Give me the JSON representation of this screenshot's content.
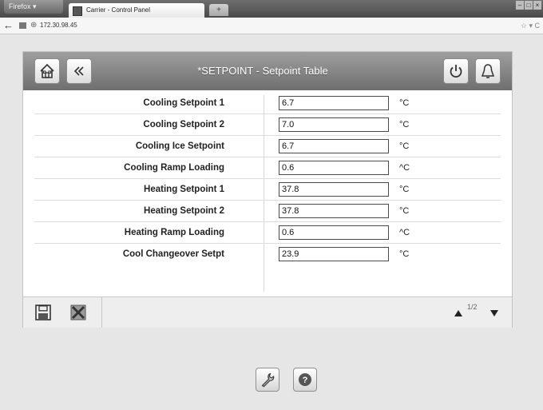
{
  "browser": {
    "app_button": "Firefox ▾",
    "tab_title": "Carrier - Control Panel",
    "new_tab_symbol": "+",
    "url": "172.30.98.45"
  },
  "header": {
    "title": "*SETPOINT - Setpoint Table"
  },
  "setpoints": [
    {
      "label": "Cooling Setpoint 1",
      "value": "6.7",
      "unit": "°C"
    },
    {
      "label": "Cooling Setpoint 2",
      "value": "7.0",
      "unit": "°C"
    },
    {
      "label": "Cooling Ice Setpoint",
      "value": "6.7",
      "unit": "°C"
    },
    {
      "label": "Cooling Ramp Loading",
      "value": "0.6",
      "unit": "^C"
    },
    {
      "label": "Heating Setpoint 1",
      "value": "37.8",
      "unit": "°C"
    },
    {
      "label": "Heating Setpoint 2",
      "value": "37.8",
      "unit": "°C"
    },
    {
      "label": "Heating Ramp Loading",
      "value": "0.6",
      "unit": "^C"
    },
    {
      "label": "Cool Changeover Setpt",
      "value": "23.9",
      "unit": "°C"
    }
  ],
  "pager": {
    "page": "1/2"
  },
  "icons": {
    "home": "home-icon",
    "back": "double-chevron-left-icon",
    "power": "power-icon",
    "alarm": "alarm-bell-icon",
    "save": "floppy-disk-icon",
    "cancel": "cancel-x-icon",
    "wrench": "wrench-icon",
    "help": "help-icon"
  }
}
